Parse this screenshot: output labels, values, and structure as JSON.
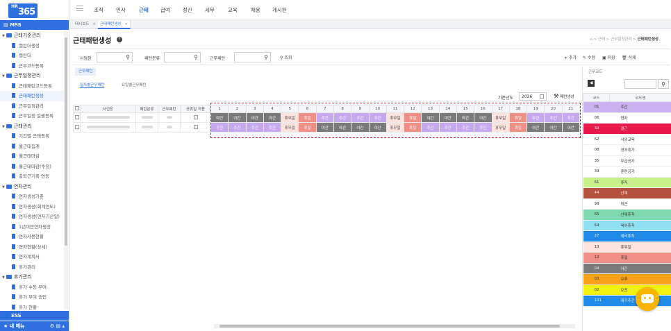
{
  "app": {
    "logo_small": "HR",
    "logo_big": "365"
  },
  "sidebar": {
    "mss_label": "MSS",
    "ess_label": "ESS",
    "my_menu_label": "내 메뉴",
    "menu": [
      {
        "type": "group",
        "label": "근태기준관리"
      },
      {
        "type": "item",
        "label": "캘린더생성"
      },
      {
        "type": "item",
        "label": "캘린더"
      },
      {
        "type": "item",
        "label": "근무코드등록"
      },
      {
        "type": "group",
        "label": "근무일정관리"
      },
      {
        "type": "item",
        "label": "근태패턴코드등록"
      },
      {
        "type": "item",
        "label": "근태패턴생성",
        "active": true
      },
      {
        "type": "item",
        "label": "근무일정관리"
      },
      {
        "type": "item",
        "label": "근무일정 일괄등록"
      },
      {
        "type": "group",
        "label": "근태관리"
      },
      {
        "type": "item",
        "label": "기간별 근태등록"
      },
      {
        "type": "item",
        "label": "월근태집계"
      },
      {
        "type": "item",
        "label": "월근태마감"
      },
      {
        "type": "item",
        "label": "월근태마감(수정)"
      },
      {
        "type": "item",
        "label": "출퇴근기록 연동"
      },
      {
        "type": "group",
        "label": "연차관리"
      },
      {
        "type": "item",
        "label": "연차생성기준"
      },
      {
        "type": "item",
        "label": "연차생성(회계연도)"
      },
      {
        "type": "item",
        "label": "연차생성(연차기산일)"
      },
      {
        "type": "item",
        "label": "1년미만연차생성"
      },
      {
        "type": "item",
        "label": "연차사용현황"
      },
      {
        "type": "item",
        "label": "연차현황(상세)"
      },
      {
        "type": "item",
        "label": "연차계획서"
      },
      {
        "type": "item",
        "label": "휴가관리"
      },
      {
        "type": "group",
        "label": "휴가관리"
      },
      {
        "type": "item",
        "label": "휴가 수동 부여"
      },
      {
        "type": "item",
        "label": "휴가 부여 승인"
      },
      {
        "type": "item",
        "label": "휴가 현황"
      }
    ]
  },
  "topnav": [
    "조직",
    "인사",
    "근태",
    "급여",
    "정산",
    "세무",
    "교육",
    "채용",
    "게시판"
  ],
  "topnav_active": "근태",
  "tabs": [
    {
      "label": "대시보드",
      "active": false
    },
    {
      "label": "근태패턴생성",
      "active": true
    }
  ],
  "page": {
    "title": "근태패턴생성",
    "breadcrumb_prefix": "⌂ > 근태 > 근무일정관리 >",
    "breadcrumb_current": "근태패턴생성"
  },
  "filters": {
    "f1": "사업장",
    "f2": "패턴분류",
    "f3": "근무패턴",
    "search_btn": "조회",
    "add_btn": "추가",
    "edit_btn": "수정",
    "save_btn": "저장",
    "delete_btn": "삭제"
  },
  "panel": {
    "label": "근무패턴",
    "subtab1": "일자별근무패턴",
    "subtab2": "요일별근무패턴",
    "year_label": "기준년도",
    "year_value": "2026",
    "generate_btn": "패턴생성"
  },
  "grid": {
    "fixed_headers": [
      "사업장",
      "패턴분류",
      "근무패턴",
      "공휴일 적용"
    ],
    "days": [
      "1",
      "2",
      "3",
      "4",
      "5",
      "6",
      "7",
      "8",
      "9",
      "10",
      "11",
      "12",
      "13",
      "14",
      "15",
      "16",
      "17",
      "18",
      "19",
      "20",
      "21"
    ],
    "rows": [
      [
        "야간",
        "야간",
        "야간",
        "야간",
        "휴무일",
        "휴일",
        "주간",
        "주간",
        "주간",
        "주간",
        "휴무일",
        "휴일",
        "야간",
        "야간",
        "야간",
        "야간",
        "휴무일",
        "휴일",
        "주간",
        "주간",
        "주간"
      ],
      [
        "주간",
        "주간",
        "주간",
        "주간",
        "휴무일",
        "휴일",
        "야간",
        "야간",
        "야간",
        "야간",
        "휴무일",
        "휴일",
        "주간",
        "주간",
        "주간",
        "주간",
        "휴무일",
        "휴일",
        "야간",
        "야간",
        "야간"
      ]
    ]
  },
  "shift_colors": {
    "주간": "#c5a8ee",
    "야간": "#7a7a7a",
    "휴무일": "#fde3de",
    "휴일": "#ef8f86"
  },
  "codes": {
    "title": "근무코드",
    "headers": [
      "코드",
      "코드명"
    ],
    "rows": [
      {
        "code": "01",
        "name": "주간",
        "bg": "#c9b3f1"
      },
      {
        "code": "06",
        "name": "연차",
        "bg": "#ffffff"
      },
      {
        "code": "39",
        "name": "결근",
        "bg": "#e8194a"
      },
      {
        "code": "62",
        "name": "사외교육",
        "bg": "#ffffff"
      },
      {
        "code": "08",
        "name": "경조휴가",
        "bg": "#ffffff"
      },
      {
        "code": "35",
        "name": "무급공가",
        "bg": "#ffffff"
      },
      {
        "code": "39",
        "name": "훈련공가",
        "bg": "#ffffff"
      },
      {
        "code": "61",
        "name": "휴직",
        "bg": "#c7f28a"
      },
      {
        "code": "44",
        "name": "산재",
        "bg": "#b5513f"
      },
      {
        "code": "98",
        "name": "퇴근",
        "bg": "#ffffff"
      },
      {
        "code": "65",
        "name": "산재휴직",
        "bg": "#7fd9b0"
      },
      {
        "code": "64",
        "name": "육아휴직",
        "bg": "#8fe0f2"
      },
      {
        "code": "27",
        "name": "예비휴직",
        "bg": "#1f8ae8"
      },
      {
        "code": "13",
        "name": "휴무일",
        "bg": "#fde3de"
      },
      {
        "code": "12",
        "name": "휴일",
        "bg": "#ef8f86"
      },
      {
        "code": "04",
        "name": "야간",
        "bg": "#7a7a7a"
      },
      {
        "code": "03",
        "name": "오후",
        "bg": "#f7a218"
      },
      {
        "code": "02",
        "name": "오전",
        "bg": "#f2f210"
      },
      {
        "code": "101",
        "name": "대기주간",
        "bg": "#1f8ae8"
      }
    ]
  }
}
